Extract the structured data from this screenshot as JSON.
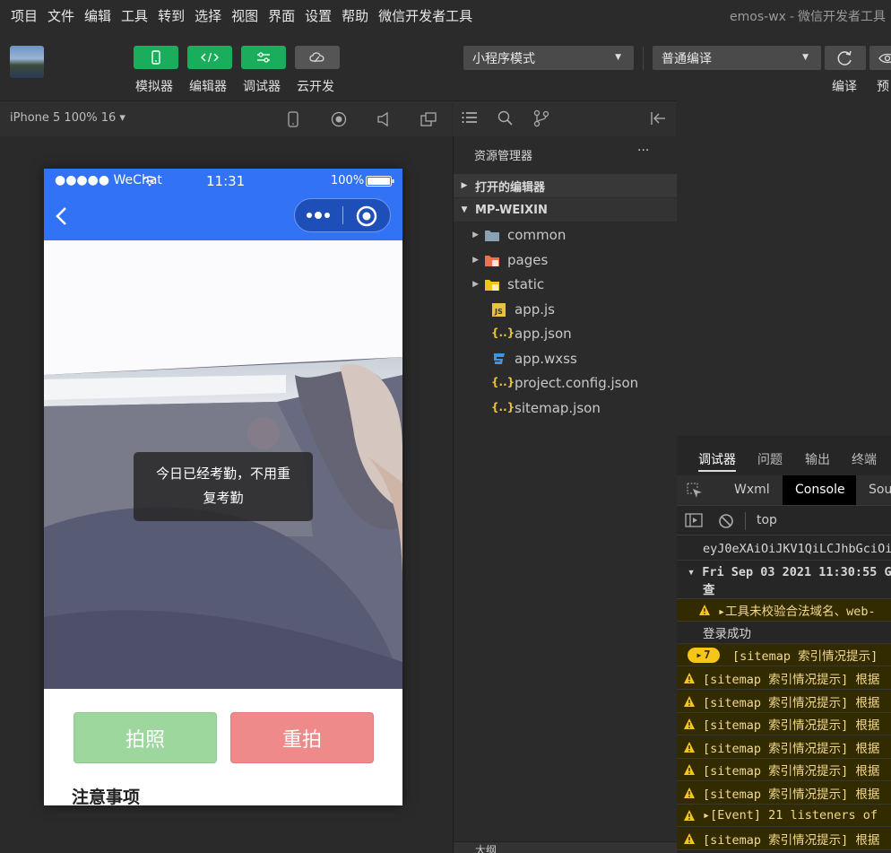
{
  "menubar": {
    "items": [
      "项目",
      "文件",
      "编辑",
      "工具",
      "转到",
      "选择",
      "视图",
      "界面",
      "设置",
      "帮助",
      "微信开发者工具"
    ],
    "project": "emos-wx",
    "separator": "-",
    "app_name": "微信开发者工具"
  },
  "toolbar": {
    "buttons": [
      {
        "label": "模拟器",
        "icon": "phone-icon"
      },
      {
        "label": "编辑器",
        "icon": "code-icon"
      },
      {
        "label": "调试器",
        "icon": "sliders-icon"
      },
      {
        "label": "云开发",
        "icon": "cloud-icon"
      }
    ],
    "mode_select": "小程序模式",
    "compile_select": "普通编译",
    "compile_label": "编译",
    "preview_label": "预",
    "accent_green": "#1aad5b"
  },
  "simulator": {
    "device": "iPhone 5 100% 16 ▾",
    "status": {
      "carrier": "●●●●● WeChat",
      "time": "11:31",
      "battery": "100%"
    },
    "nav_color": "#3273f6",
    "toast": "今日已经考勤，不用重复考勤",
    "photo_button": "拍照",
    "retake_button": "重拍",
    "notice_heading": "注意事项"
  },
  "explorer": {
    "title": "资源管理器",
    "more": "···",
    "open_editors": "打开的编辑器",
    "project": "MP-WEIXIN",
    "items": [
      {
        "name": "common",
        "icon": "folder-icon",
        "folder": true
      },
      {
        "name": "pages",
        "icon": "pages-folder-icon",
        "folder": true
      },
      {
        "name": "static",
        "icon": "static-folder-icon",
        "folder": true
      },
      {
        "name": "app.js",
        "icon": "js-file-icon",
        "folder": false
      },
      {
        "name": "app.json",
        "icon": "json-file-icon",
        "folder": false
      },
      {
        "name": "app.wxss",
        "icon": "css-file-icon",
        "folder": false
      },
      {
        "name": "project.config.json",
        "icon": "json-file-icon",
        "folder": false
      },
      {
        "name": "sitemap.json",
        "icon": "json-file-icon",
        "folder": false
      }
    ],
    "bottom_label": "大纲"
  },
  "debugger": {
    "tabs": [
      "调试器",
      "问题",
      "输出",
      "终端"
    ],
    "subtabs": [
      "Wxml",
      "Console",
      "Sou"
    ],
    "context": "top",
    "logs": [
      {
        "type": "plain",
        "text": "eyJ0eXAiOiJKV1QiLCJhbGciOi"
      },
      {
        "type": "group",
        "text": "▾ Fri Sep 03 2021 11:30:55 G"
      },
      {
        "type": "plain2",
        "text": "查"
      },
      {
        "type": "warn",
        "text": "▸工具未校验合法域名、web-"
      },
      {
        "type": "plain",
        "text": "登录成功"
      },
      {
        "type": "badge",
        "count": "7",
        "text": "[sitemap 索引情况提示]"
      },
      {
        "type": "warn",
        "text": "[sitemap 索引情况提示] 根据"
      },
      {
        "type": "warn",
        "text": "[sitemap 索引情况提示] 根据"
      },
      {
        "type": "warn",
        "text": "[sitemap 索引情况提示] 根据"
      },
      {
        "type": "warn",
        "text": "[sitemap 索引情况提示] 根据"
      },
      {
        "type": "warn",
        "text": "[sitemap 索引情况提示] 根据"
      },
      {
        "type": "warn",
        "text": "[sitemap 索引情况提示] 根据"
      },
      {
        "type": "warn",
        "text": "▸[Event] 21 listeners of"
      },
      {
        "type": "warn",
        "text": "[sitemap 索引情况提示] 根据"
      }
    ]
  }
}
